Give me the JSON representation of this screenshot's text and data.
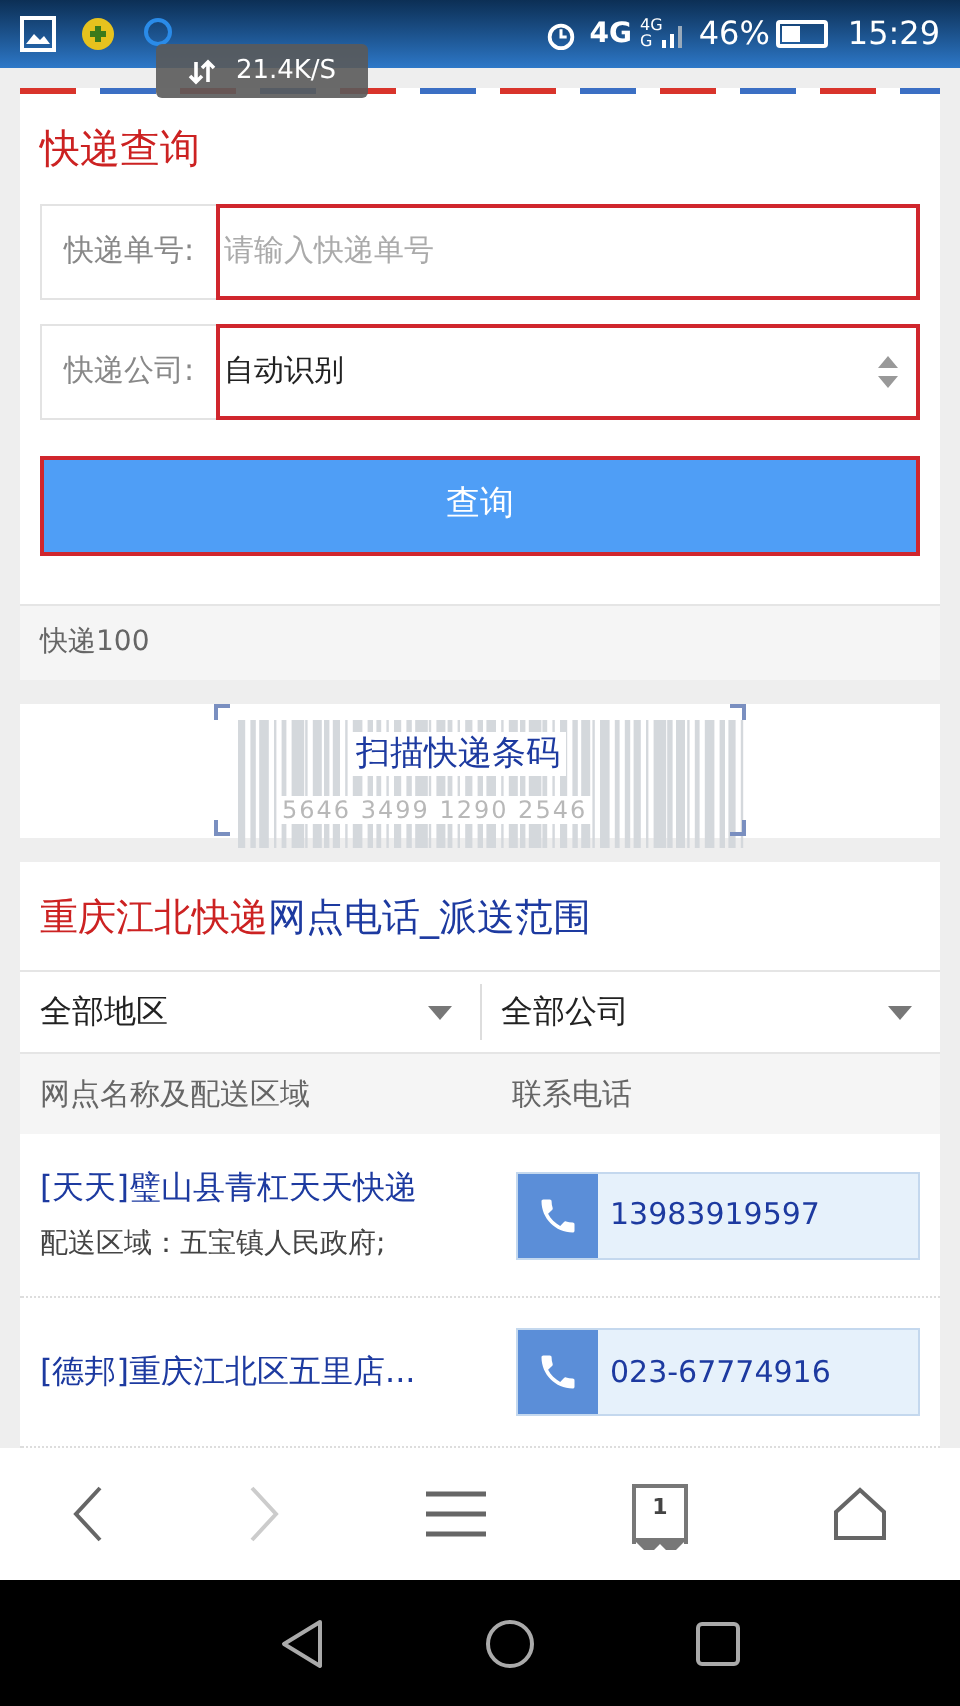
{
  "status_bar": {
    "speed": "21.4K/S",
    "network": "4G",
    "signal_labels": [
      "4G",
      "G"
    ],
    "battery": "46%",
    "time": "15:29"
  },
  "query": {
    "title": "快递查询",
    "fields": [
      {
        "kind": "input",
        "label": "快递单号:",
        "placeholder": "请输入快递单号"
      },
      {
        "kind": "select",
        "label": "快递公司:",
        "value": "自动识别"
      }
    ],
    "button": "查询"
  },
  "brand": "快递100",
  "scan": {
    "label": "扫描快递条码",
    "digits": "5646 3499 1290 2546"
  },
  "outlets": {
    "title_highlight": "重庆江北快递",
    "title_rest": "网点电话_派送范围",
    "filters": [
      "全部地区",
      "全部公司"
    ],
    "columns": [
      "网点名称及配送区域",
      "联系电话"
    ],
    "rows": [
      {
        "name": "[天天]璧山县青杠天天快递",
        "area": "配送区域：五宝镇人民政府;",
        "phone": "13983919597"
      },
      {
        "name": "[德邦]重庆江北区五里店...",
        "phone": "023-67774916"
      }
    ]
  },
  "browser_bar": {
    "tab_count": "1"
  }
}
